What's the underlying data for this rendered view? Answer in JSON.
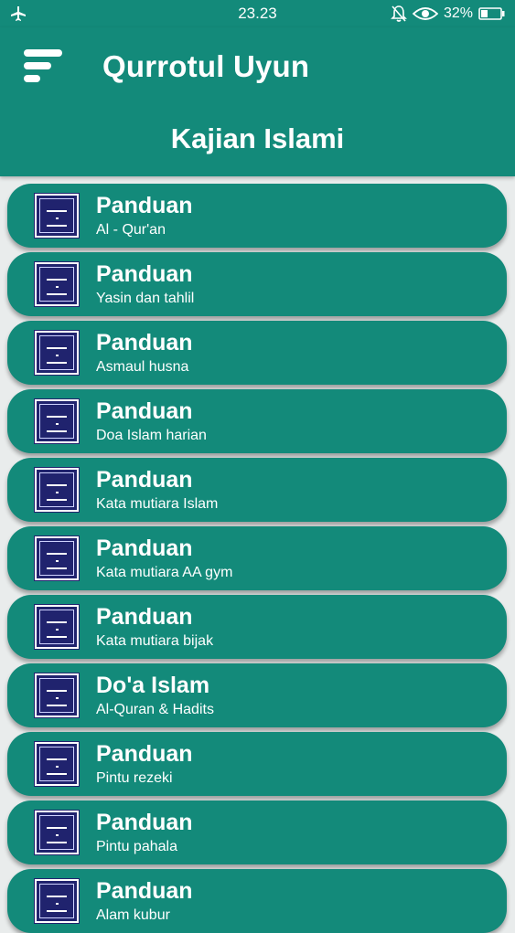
{
  "status_bar": {
    "time": "23.23",
    "battery": "32%",
    "icons": [
      "airplane-mode-icon",
      "bell-muted-icon",
      "eye-icon",
      "battery-icon"
    ]
  },
  "header": {
    "app_title": "Qurrotul Uyun",
    "section_title": "Kajian Islami",
    "menu_icon": "hamburger-menu-icon"
  },
  "colors": {
    "primary": "#138a7a",
    "background": "#e9ecec",
    "logo": "#20236e",
    "text": "#ffffff"
  },
  "items": [
    {
      "title": "Panduan",
      "subtitle": "Al - Qur'an",
      "logo": "Qurrotul Uyun & Fathul Izar"
    },
    {
      "title": "Panduan",
      "subtitle": "Yasin dan tahlil",
      "logo": "Qurrotul Uyun & Fathul Izar"
    },
    {
      "title": "Panduan",
      "subtitle": "Asmaul husna",
      "logo": "Qurrotul Uyun & Fathul Izar"
    },
    {
      "title": "Panduan",
      "subtitle": "Doa Islam harian",
      "logo": "Qurrotul Uyun & Fathul Izar"
    },
    {
      "title": "Panduan",
      "subtitle": "Kata mutiara Islam",
      "logo": "Qurrotul Uyun & Fathul Izar"
    },
    {
      "title": "Panduan",
      "subtitle": "Kata mutiara AA gym",
      "logo": "Qurrotul Uyun & Fathul Izar"
    },
    {
      "title": "Panduan",
      "subtitle": "Kata mutiara bijak",
      "logo": "Qurrotul Uyun & Fathul Izar"
    },
    {
      "title": "Do'a Islam",
      "subtitle": "Al-Quran & Hadits",
      "logo": "Qurrotul Uyun & Fathul Izar"
    },
    {
      "title": "Panduan",
      "subtitle": "Pintu rezeki",
      "logo": "Qurrotul Uyun & Fathul Izar"
    },
    {
      "title": "Panduan",
      "subtitle": "Pintu pahala",
      "logo": "Qurrotul Uyun & Fathul Izar"
    },
    {
      "title": "Panduan",
      "subtitle": "Alam kubur",
      "logo": "Qurrotul Uyun & Fathul Izar"
    }
  ]
}
